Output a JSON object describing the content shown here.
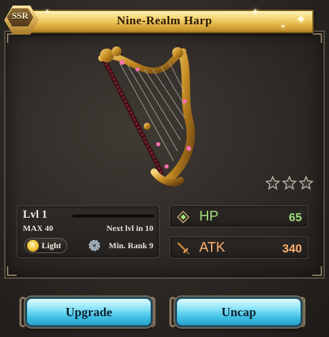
{
  "header": {
    "rarity": "SSR",
    "title": "Nine-Realm Harp"
  },
  "rating": {
    "stars_total": 3,
    "stars_filled": 0
  },
  "level": {
    "label": "Lvl 1",
    "max": "MAX 40",
    "next": "Next lvl in 10",
    "element": "Light",
    "min_rank": "Min. Rank 9",
    "progress": 0
  },
  "stats": {
    "hp_label": "HP",
    "hp_value": "65",
    "atk_label": "ATK",
    "atk_value": "340"
  },
  "buttons": {
    "upgrade": "Upgrade",
    "uncap": "Uncap"
  },
  "icons": {
    "element_icon": "light-element-icon",
    "skill_icon": "gear-icon",
    "hp_icon": "hp-diamond-icon",
    "atk_icon": "atk-sword-icon",
    "star_icon": "star-outline-icon"
  },
  "colors": {
    "title_gold": "#d8a93a",
    "button_cyan": "#3fc0e4",
    "hp_green": "#9fe07a",
    "atk_orange": "#ffb070"
  }
}
